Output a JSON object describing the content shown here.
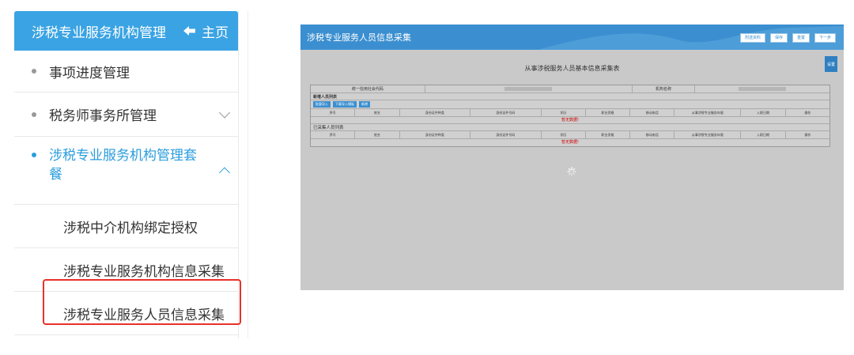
{
  "sidebar": {
    "header_title": "涉税专业服务机构管理",
    "home_label": "主页",
    "items": [
      {
        "label": "事项进度管理"
      },
      {
        "label": "税务师事务所管理"
      },
      {
        "label": "涉税专业服务机构管理套餐"
      }
    ],
    "subitems": [
      {
        "label": "涉税中介机构绑定授权"
      },
      {
        "label": "涉税专业服务机构信息采集"
      },
      {
        "label": "涉税专业服务人员信息采集"
      }
    ]
  },
  "screenshot": {
    "title": "涉税专业服务人员信息采集",
    "top_buttons": [
      "附送资料",
      "保存",
      "重置",
      "下一步"
    ],
    "settings_label": "设置",
    "form_title": "从事涉税服务人员基本信息采集表",
    "org_row": {
      "label1": "统一信用社会代码",
      "label2": "机构名称"
    },
    "new_section_label": "新增人员列表",
    "action_buttons": [
      "批量导入",
      "下载导入模板",
      "新增"
    ],
    "columns": [
      "序号",
      "姓名",
      "身份证件种类",
      "身份证件号码",
      "学历",
      "职业资格",
      "移动电话",
      "从事涉税专业服务年限",
      "入职日期",
      "操作"
    ],
    "empty_text": "暂无数据!",
    "collected_section_label": "已采集人员列表"
  },
  "colors": {
    "accent": "#3aa3e3",
    "highlight": "#e8312a",
    "empty_text": "#cc0000"
  }
}
